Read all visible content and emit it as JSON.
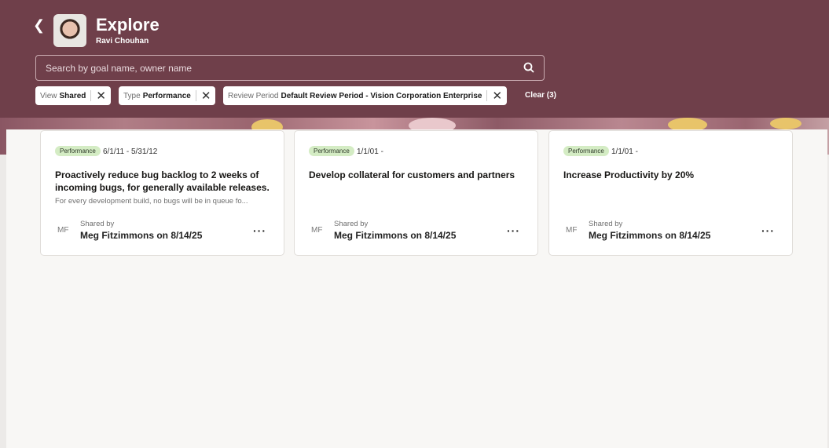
{
  "header": {
    "title": "Explore",
    "user": "Ravi Chouhan",
    "search_placeholder": "Search by goal name, owner name"
  },
  "filters": [
    {
      "key": "View",
      "value": "Shared"
    },
    {
      "key": "Type",
      "value": "Performance"
    },
    {
      "key": "Review Period",
      "value": "Default Review Period - Vision Corporation Enterprise"
    }
  ],
  "clear_label": "Clear (3)",
  "colors": {
    "header": "#6f3f4a",
    "badge": "#d4ecc4"
  },
  "cards": [
    {
      "badge": "Performance",
      "dates": "6/1/11 - 5/31/12",
      "title": "Proactively reduce bug backlog to 2 weeks of incoming bugs, for generally available releases.",
      "description": "For every development build, no bugs will be in queue fo...",
      "initials": "MF",
      "shared_label": "Shared by",
      "owner": "Meg Fitzimmons on 8/14/25"
    },
    {
      "badge": "Performance",
      "dates": "1/1/01 -",
      "title": "Develop collateral for customers and partners",
      "description": "",
      "initials": "MF",
      "shared_label": "Shared by",
      "owner": "Meg Fitzimmons on 8/14/25"
    },
    {
      "badge": "Performance",
      "dates": "1/1/01 -",
      "title": "Increase Productivity by 20%",
      "description": "",
      "initials": "MF",
      "shared_label": "Shared by",
      "owner": "Meg Fitzimmons on 8/14/25"
    }
  ]
}
